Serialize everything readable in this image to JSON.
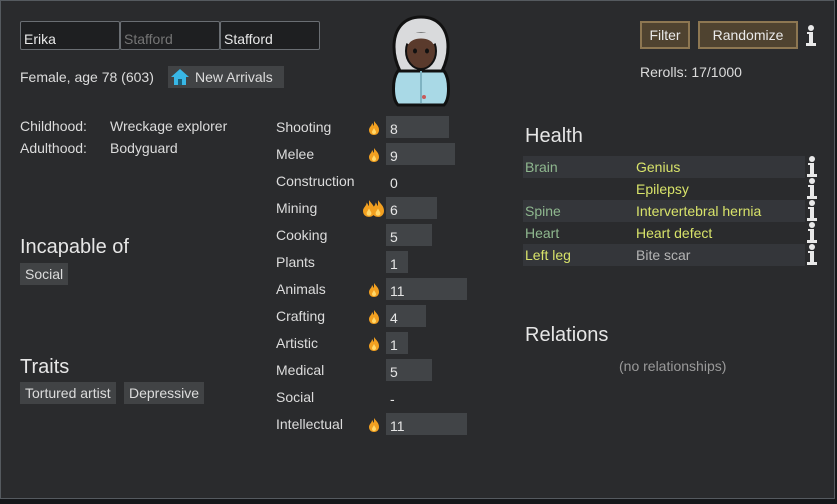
{
  "pawn": {
    "first_name": "Erika",
    "nick_name_placeholder": "Stafford",
    "last_name": "Stafford",
    "summary": "Female, age 78 (603)",
    "faction": "New Arrivals"
  },
  "controls": {
    "filter_label": "Filter",
    "randomize_label": "Randomize",
    "rerolls": "Rerolls: 17/1000"
  },
  "backstory": {
    "childhood_label": "Childhood:",
    "childhood": "Wreckage explorer",
    "adulthood_label": "Adulthood:",
    "adulthood": "Bodyguard"
  },
  "incapable": {
    "title": "Incapable of",
    "items": [
      "Social"
    ]
  },
  "traits": {
    "title": "Traits",
    "items": [
      "Tortured artist",
      "Depressive"
    ]
  },
  "skills": [
    {
      "name": "Shooting",
      "level": "8",
      "passion": 1,
      "bar": 8
    },
    {
      "name": "Melee",
      "level": "9",
      "passion": 1,
      "bar": 9
    },
    {
      "name": "Construction",
      "level": "0",
      "passion": 0,
      "bar": 0
    },
    {
      "name": "Mining",
      "level": "6",
      "passion": 2,
      "bar": 6
    },
    {
      "name": "Cooking",
      "level": "5",
      "passion": 0,
      "bar": 5
    },
    {
      "name": "Plants",
      "level": "1",
      "passion": 0,
      "bar": 1
    },
    {
      "name": "Animals",
      "level": "11",
      "passion": 1,
      "bar": 11
    },
    {
      "name": "Crafting",
      "level": "4",
      "passion": 1,
      "bar": 4
    },
    {
      "name": "Artistic",
      "level": "1",
      "passion": 1,
      "bar": 1
    },
    {
      "name": "Medical",
      "level": "5",
      "passion": 0,
      "bar": 5
    },
    {
      "name": "Social",
      "level": "-",
      "passion": 0,
      "bar": 0
    },
    {
      "name": "Intellectual",
      "level": "11",
      "passion": 1,
      "bar": 11
    }
  ],
  "health": {
    "title": "Health",
    "rows": [
      {
        "part": "Brain",
        "condition": "Genius",
        "part_color": "#8fb88f",
        "cond_color": "#d8e36a"
      },
      {
        "part": "",
        "condition": "Epilepsy",
        "part_color": "#8fb88f",
        "cond_color": "#d8e36a"
      },
      {
        "part": "Spine",
        "condition": "Intervertebral hernia",
        "part_color": "#8fb88f",
        "cond_color": "#d8e36a"
      },
      {
        "part": "Heart",
        "condition": "Heart defect",
        "part_color": "#8fb88f",
        "cond_color": "#d8e36a"
      },
      {
        "part": "Left leg",
        "condition": "Bite scar",
        "part_color": "#d8e36a",
        "cond_color": "#b4b4b4"
      }
    ]
  },
  "relations": {
    "title": "Relations",
    "empty_text": "(no relationships)"
  },
  "colors": {
    "panel_bg": "#2a2b2d",
    "button_bg": "#4f4330",
    "button_border": "#8d7752",
    "passion_flame": "#f2a020"
  }
}
